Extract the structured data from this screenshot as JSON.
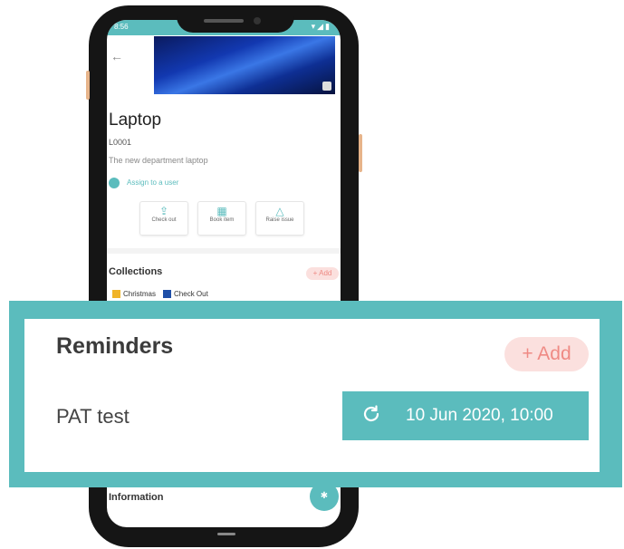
{
  "status_bar": {
    "time": "8:56",
    "icons": "▾◢▮"
  },
  "asset": {
    "title": "Laptop",
    "code": "L0001",
    "description": "The new department laptop",
    "assign_label": "Assign to a user"
  },
  "actions": [
    {
      "label": "Check out",
      "icon": "upload-icon"
    },
    {
      "label": "Book item",
      "icon": "calendar-icon"
    },
    {
      "label": "Raise issue",
      "icon": "warning-icon"
    }
  ],
  "collections": {
    "title": "Collections",
    "add_label": "+ Add",
    "chips": [
      {
        "label": "Christmas",
        "color": "#f0b429"
      },
      {
        "label": "Check Out",
        "color": "#1f4fa8"
      }
    ]
  },
  "reminders": {
    "title": "Reminders",
    "add_label": "+ Add",
    "item": {
      "name": "PAT test",
      "date": "10 Jun 2020, 10:00",
      "icon": "repeat-icon"
    }
  },
  "information": {
    "title": "Information"
  },
  "colors": {
    "accent": "#5bbcbd",
    "add_bg": "#fbe0de",
    "add_text": "#ef8a84",
    "phone": "#151515"
  }
}
